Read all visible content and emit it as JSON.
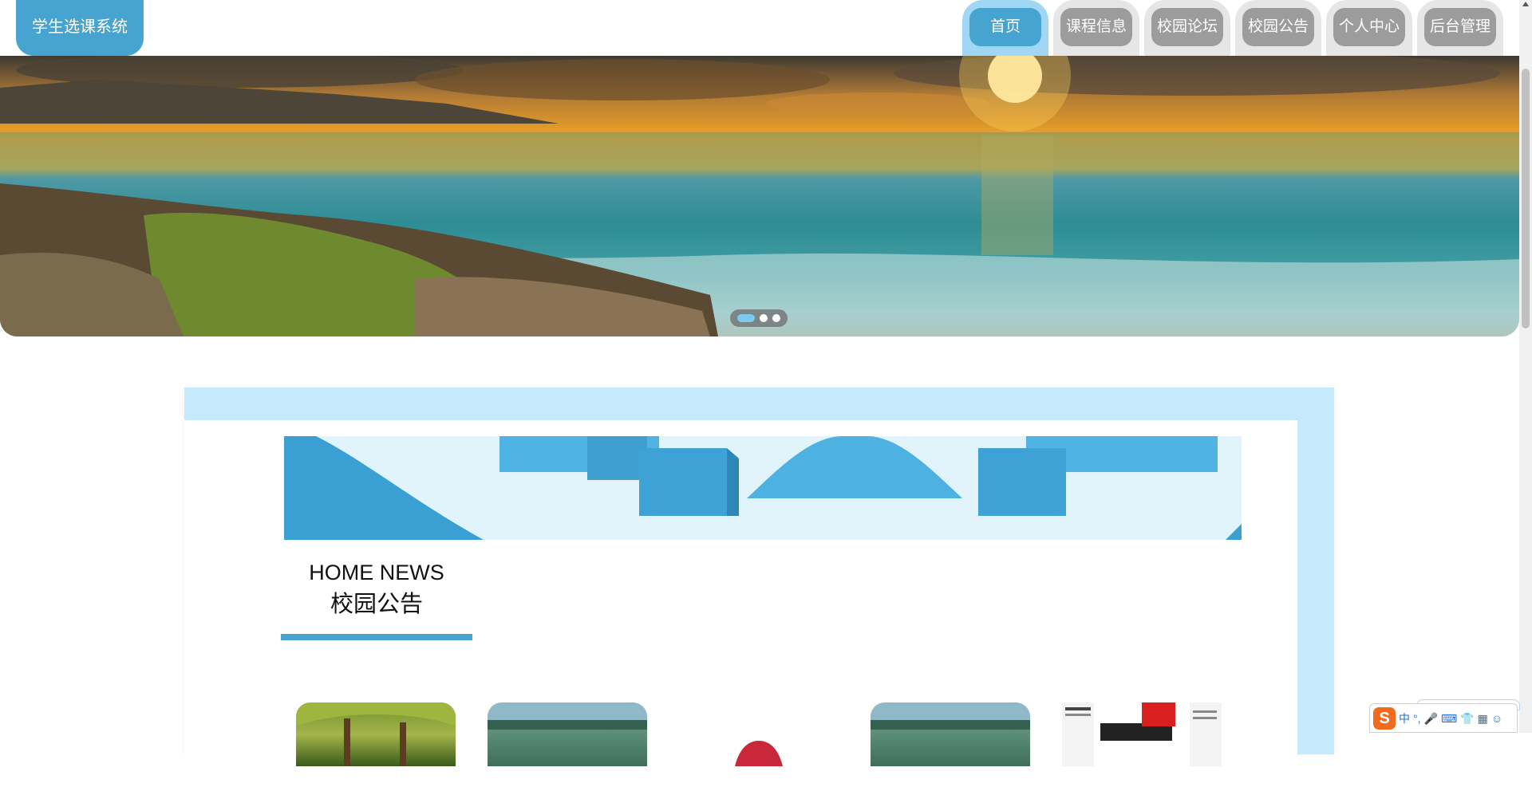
{
  "header": {
    "logo": "学生选课系统",
    "nav": [
      {
        "label": "首页",
        "active": true
      },
      {
        "label": "课程信息"
      },
      {
        "label": "校园论坛"
      },
      {
        "label": "校园公告"
      },
      {
        "label": "个人中心"
      },
      {
        "label": "后台管理"
      }
    ]
  },
  "carousel": {
    "slides": 3,
    "active_slide": 1
  },
  "news": {
    "title_en": "HOME NEWS",
    "title_cn": "校园公告",
    "thumbnails": [
      "forest",
      "lake",
      "flag",
      "lake",
      "newspaper"
    ]
  },
  "ime_toolbar": {
    "logo": "S",
    "items": [
      "中",
      "°,",
      "🎤",
      "⌨",
      "👕",
      "▦",
      "☺"
    ]
  },
  "colors": {
    "accent": "#47a3cf",
    "nav_inactive": "#9c9c9c",
    "nav_tab_bg": "#e6e6e6",
    "card_bg": "#c5eafb"
  }
}
